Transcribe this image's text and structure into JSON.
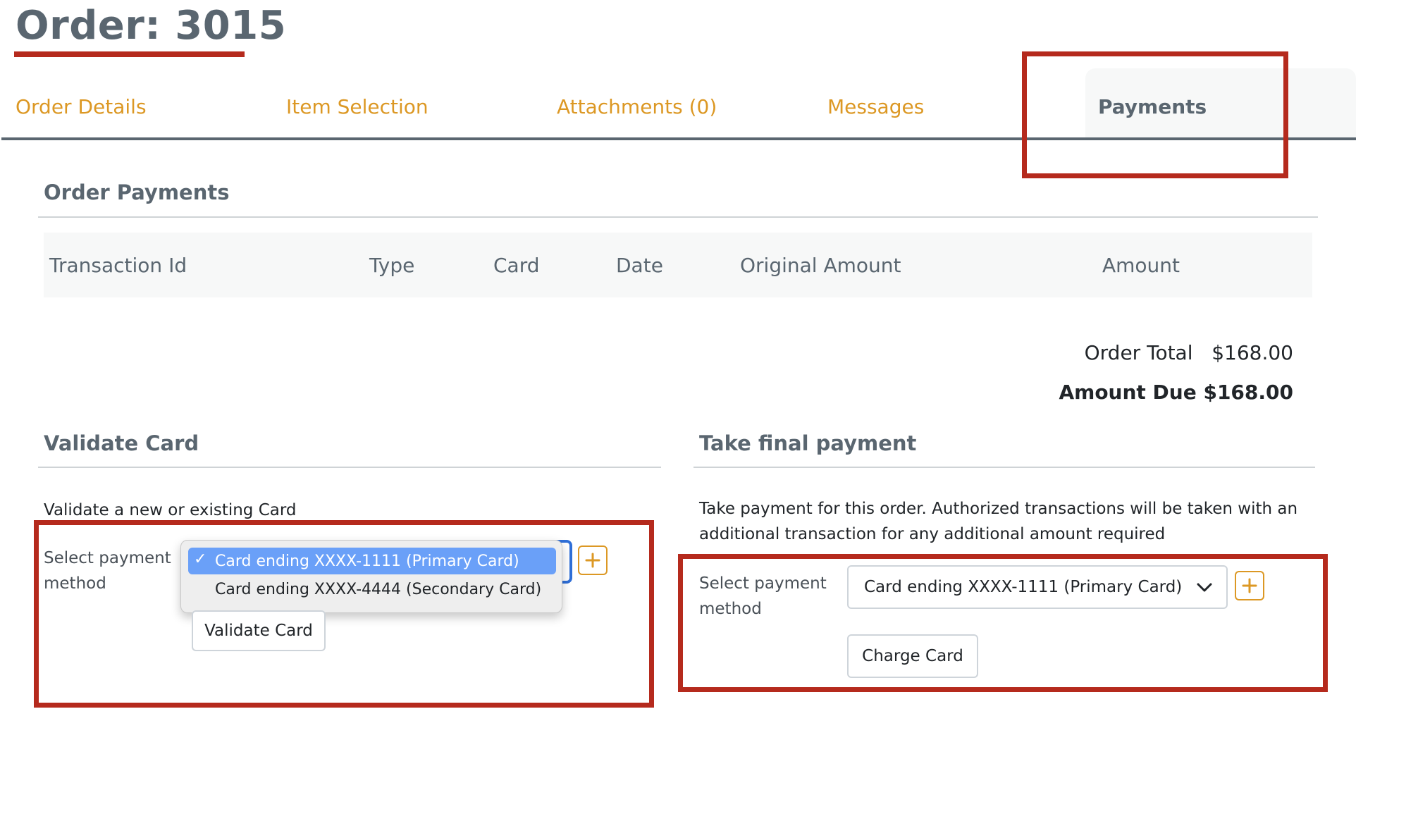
{
  "order": {
    "title": "Order: 3015"
  },
  "tabs": [
    {
      "label": "Order Details",
      "active": false
    },
    {
      "label": "Item Selection",
      "active": false
    },
    {
      "label": "Attachments (0)",
      "active": false
    },
    {
      "label": "Messages",
      "active": false
    },
    {
      "label": "Payments",
      "active": true
    }
  ],
  "payments": {
    "heading": "Order Payments",
    "columns": [
      "Transaction Id",
      "Type",
      "Card",
      "Date",
      "Original Amount",
      "Amount"
    ],
    "rows": []
  },
  "totals": {
    "order_total_label": "Order Total",
    "order_total_value": "$168.00",
    "amount_due_label": "Amount Due",
    "amount_due_value": "$168.00"
  },
  "validate": {
    "heading": "Validate Card",
    "description": "Validate a new or existing Card",
    "select_label_line1": "Select payment",
    "select_label_line2": "method",
    "options": [
      "Card ending XXXX-1111 (Primary Card)",
      "Card ending XXXX-4444 (Secondary Card)"
    ],
    "selected_index": 0,
    "button_label": "Validate Card"
  },
  "final_payment": {
    "heading": "Take final payment",
    "description_line1": "Take payment for this order. Authorized transactions will be taken with an",
    "description_line2": "additional transaction for any additional amount required",
    "select_label_line1": "Select payment",
    "select_label_line2": "method",
    "selected_value": "Card ending XXXX-1111 (Primary Card)",
    "button_label": "Charge Card"
  },
  "colors": {
    "accent": "#dc9824",
    "heading": "#5a6670",
    "annotation": "#b52a1d",
    "dropdown_highlight": "#6aa0f8"
  }
}
